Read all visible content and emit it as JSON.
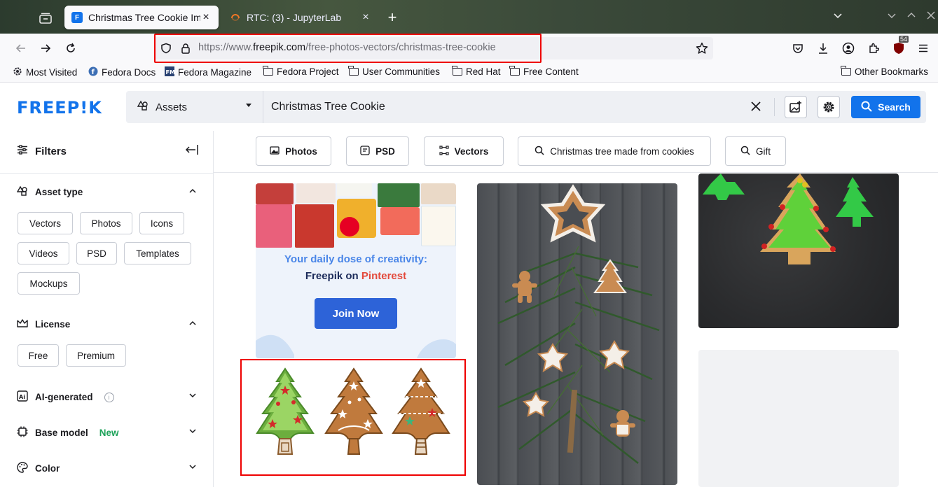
{
  "browser": {
    "tabs": [
      {
        "title": "Christmas Tree Cookie Ima",
        "favicon": "freepik-favicon-icon",
        "active": true
      },
      {
        "title": "RTC: (3) - JupyterLab",
        "favicon": "jupyter-favicon-icon",
        "active": false
      }
    ],
    "url": {
      "prefix": "https://www.",
      "domain": "freepik.com",
      "path": "/free-photos-vectors/christmas-tree-cookie"
    },
    "extension_badge": "54",
    "bookmarks": [
      {
        "label": "Most Visited",
        "icon": "gear-icon"
      },
      {
        "label": "Fedora Docs",
        "icon": "fedora-icon"
      },
      {
        "label": "Fedora Magazine",
        "icon": "fm-icon"
      },
      {
        "label": "Fedora Project",
        "icon": "folder-icon"
      },
      {
        "label": "User Communities",
        "icon": "folder-icon"
      },
      {
        "label": "Red Hat",
        "icon": "folder-icon"
      },
      {
        "label": "Free Content",
        "icon": "folder-icon"
      }
    ],
    "other_bookmarks": "Other Bookmarks"
  },
  "header": {
    "logo": "FREEP!K",
    "assets_label": "Assets",
    "search_value": "Christmas Tree Cookie",
    "search_button": "Search",
    "brand_color": "#1273eb"
  },
  "sidebar": {
    "title": "Filters",
    "sections": {
      "asset_type": {
        "title": "Asset type",
        "chips": [
          "Vectors",
          "Photos",
          "Icons",
          "Videos",
          "PSD",
          "Templates",
          "Mockups"
        ]
      },
      "license": {
        "title": "License",
        "chips": [
          "Free",
          "Premium"
        ]
      },
      "ai_generated": {
        "title": "AI-generated"
      },
      "base_model": {
        "title": "Base model",
        "tag": "New"
      },
      "color": {
        "title": "Color"
      }
    }
  },
  "related": [
    {
      "label": "Photos",
      "icon": "image-icon"
    },
    {
      "label": "PSD",
      "icon": "psd-icon"
    },
    {
      "label": "Vectors",
      "icon": "vector-icon"
    },
    {
      "label": "Christmas tree made from cookies",
      "icon": "search-icon"
    },
    {
      "label": "Gift",
      "icon": "search-icon"
    }
  ],
  "pinterest_card": {
    "line1": "Your daily dose of creativity:",
    "line2_a": "Freepik on ",
    "line2_b": "Pinterest",
    "button": "Join Now"
  }
}
